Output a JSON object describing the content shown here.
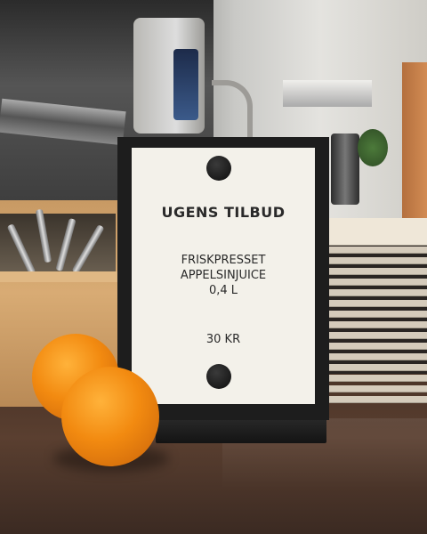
{
  "sign": {
    "title": "UGENS TILBUD",
    "product_line_1": "FRISKPRESSET",
    "product_line_2": "APPELSINJUICE",
    "product_line_3": "0,4 L",
    "price": "30 KR"
  },
  "colors": {
    "sign_card": "#f3f1ea",
    "sign_frame": "#1d1d1d",
    "orange": "#f28a10",
    "counter": "#4a3327"
  },
  "objects": [
    "sign-holder",
    "oranges",
    "cutlery-box",
    "paper-sleeve-stack",
    "espresso-machine"
  ]
}
